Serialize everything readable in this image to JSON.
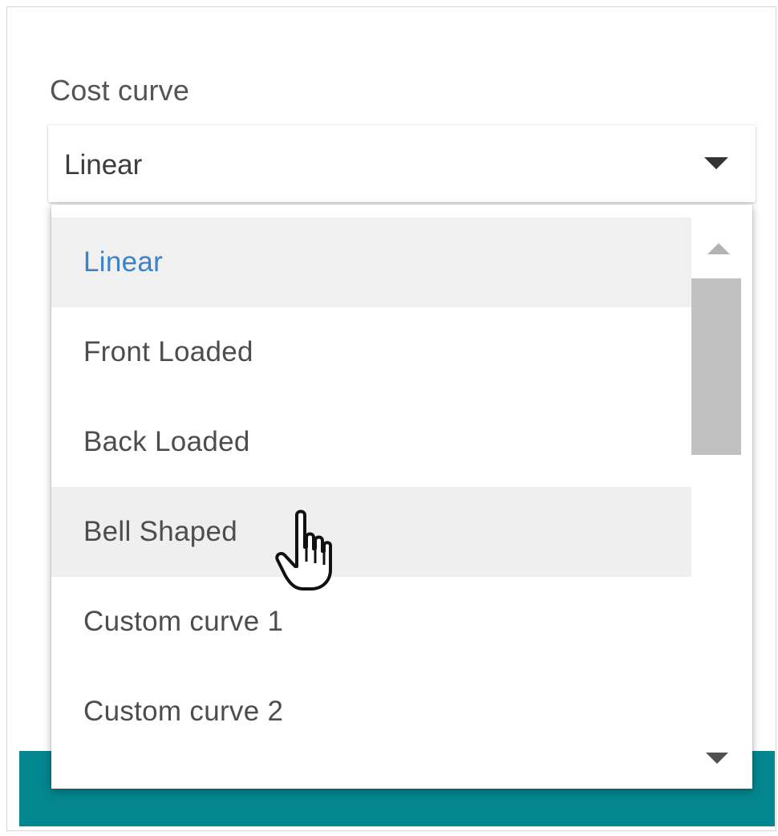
{
  "field": {
    "label": "Cost curve",
    "selected_value": "Linear"
  },
  "dropdown": {
    "options": [
      {
        "label": "Linear",
        "state": "selected"
      },
      {
        "label": "Front Loaded",
        "state": "normal"
      },
      {
        "label": "Back Loaded",
        "state": "normal"
      },
      {
        "label": "Bell Shaped",
        "state": "hovered"
      },
      {
        "label": "Custom curve 1",
        "state": "normal"
      },
      {
        "label": "Custom curve 2",
        "state": "normal"
      }
    ]
  },
  "icons": {
    "select_caret": "caret-down-icon",
    "scroll_up": "scroll-up-arrow-icon",
    "scroll_down": "scroll-down-arrow-icon",
    "cursor": "hand-pointer-cursor-icon"
  },
  "colors": {
    "selected_text": "#3c82c8",
    "hover_background": "#efefef",
    "footer_accent": "#04868f"
  }
}
